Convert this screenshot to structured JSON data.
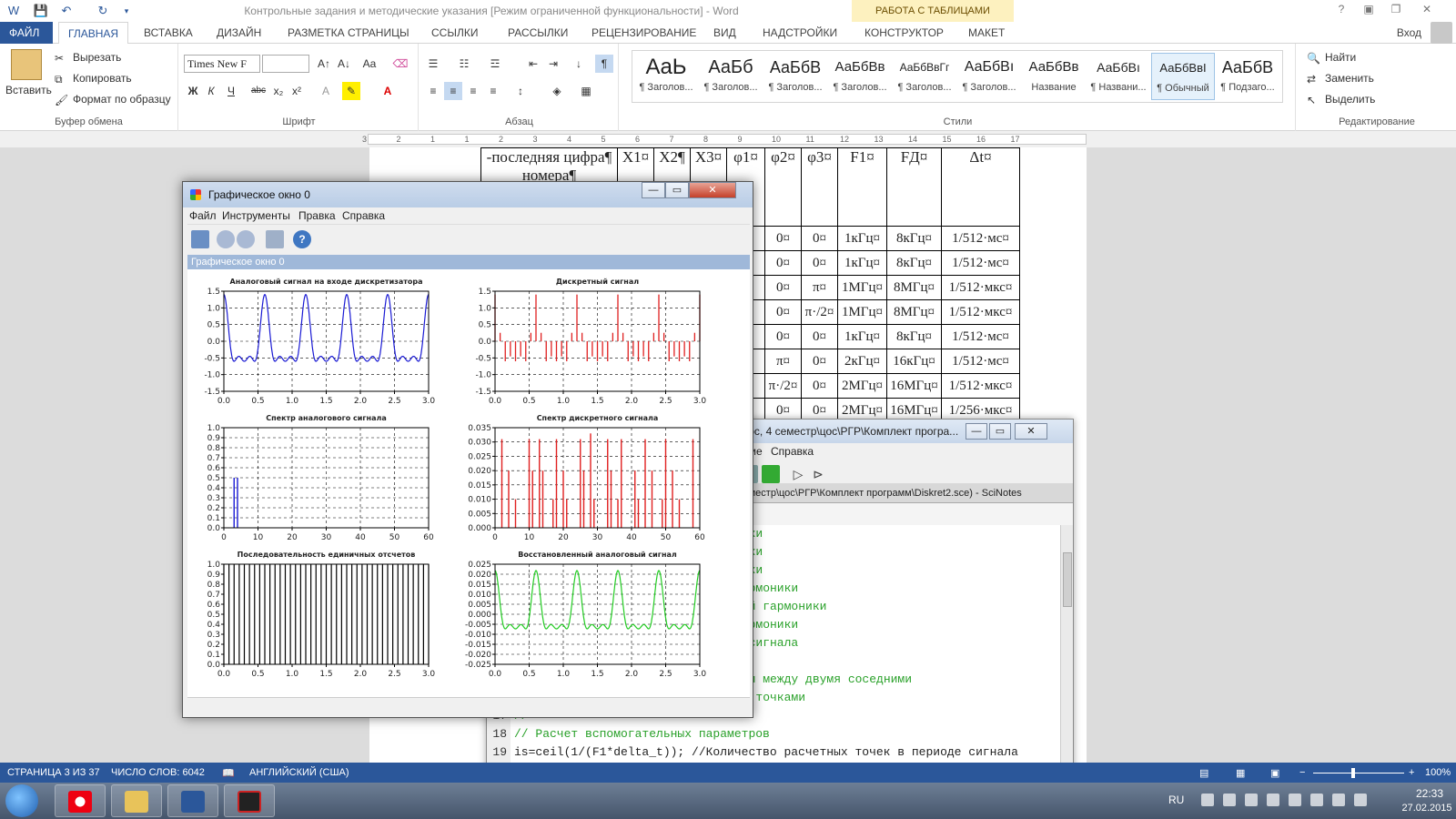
{
  "word": {
    "title": "Контрольные задания и методические указания [Режим ограниченной функциональности] - Word",
    "table_tools": "РАБОТА С ТАБЛИЦАМИ",
    "tabs": [
      "ФАЙЛ",
      "ГЛАВНАЯ",
      "ВСТАВКА",
      "ДИЗАЙН",
      "РАЗМЕТКА СТРАНИЦЫ",
      "ССЫЛКИ",
      "РАССЫЛКИ",
      "РЕЦЕНЗИРОВАНИЕ",
      "ВИД",
      "НАДСТРОЙКИ",
      "КОНСТРУКТОР",
      "МАКЕТ"
    ],
    "signin": "Вход",
    "clipboard": {
      "paste": "Вставить",
      "cut": "Вырезать",
      "copy": "Копировать",
      "format_painter": "Формат по образцу",
      "label": "Буфер обмена"
    },
    "font": {
      "name": "Times New F",
      "size": "",
      "label": "Шрифт"
    },
    "paragraph": {
      "label": "Абзац"
    },
    "styles": {
      "label": "Стили",
      "items": [
        {
          "sample": "AaЬ",
          "name": "¶ Заголов..."
        },
        {
          "sample": "АаБб",
          "name": "¶ Заголов..."
        },
        {
          "sample": "АаБбВ",
          "name": "¶ Заголов..."
        },
        {
          "sample": "АаБбВв",
          "name": "¶ Заголов..."
        },
        {
          "sample": "АаБбВвГг",
          "name": "¶ Заголов..."
        },
        {
          "sample": "АаБбВı",
          "name": "¶ Заголов..."
        },
        {
          "sample": "АаБбВв",
          "name": "Название"
        },
        {
          "sample": "АаБбВı",
          "name": "¶ Названи..."
        },
        {
          "sample": "АаБбВвI",
          "name": "¶ Обычный"
        },
        {
          "sample": "АаБбВ",
          "name": "¶ Подзаго..."
        }
      ]
    },
    "editing": {
      "find": "Найти",
      "replace": "Заменить",
      "select": "Выделить",
      "label": "Редактирование"
    },
    "ruler_numbers": [
      "3",
      "2",
      "1",
      "1",
      "2",
      "3",
      "4",
      "5",
      "6",
      "7",
      "8",
      "9",
      "10",
      "11",
      "12",
      "13",
      "14",
      "15",
      "16",
      "17"
    ],
    "table": {
      "header": [
        "-последняя цифра¶ номера¶",
        "X1¤",
        "X2¶",
        "X3¤",
        "φ1¤",
        "φ2¤",
        "φ3¤",
        "F1¤",
        "FД¤",
        "Δt¤"
      ],
      "rows": [
        [
          "",
          "",
          "",
          "",
          "0¤",
          "0¤",
          "0¤",
          "1кГц¤",
          "8кГц¤",
          "1/512·мс¤"
        ],
        [
          "",
          "",
          "",
          "",
          "0¤",
          "0¤",
          "0¤",
          "1кГц¤",
          "8кГц¤",
          "1/512·мс¤"
        ],
        [
          "",
          "",
          "",
          "",
          "0¤",
          "0¤",
          "π¤",
          "1МГц¤",
          "8МГц¤",
          "1/512·мкс¤"
        ],
        [
          "",
          "",
          "",
          "",
          "0¤",
          "0¤",
          "π·/2¤",
          "1МГц¤",
          "8МГц¤",
          "1/512·мкс¤"
        ],
        [
          "",
          "",
          "",
          "",
          "0¤",
          "0¤",
          "0¤",
          "1кГц¤",
          "8кГц¤",
          "1/512·мс¤"
        ],
        [
          "",
          "",
          "",
          "",
          "0¤",
          "π¤",
          "0¤",
          "2кГц¤",
          "16кГц¤",
          "1/512·мс¤"
        ],
        [
          "",
          "",
          "",
          "",
          "0¤",
          "π·/2¤",
          "0¤",
          "2МГц¤",
          "16МГц¤",
          "1/512·мкс¤"
        ],
        [
          "",
          "",
          "",
          "",
          "0¤",
          "0¤",
          "0¤",
          "2МГц¤",
          "16МГц¤",
          "1/256·мкс¤"
        ]
      ]
    },
    "status": {
      "page": "СТРАНИЦА 3 ИЗ 37",
      "words": "ЧИСЛО СЛОВ: 6042",
      "lang": "АНГЛИЙСКИЙ (США)",
      "zoom": "100%"
    }
  },
  "scinotes": {
    "title": "курс, 4 семестр\\цос\\РГР\\Комплект програ...",
    "menu": [
      "ение",
      "Справка"
    ],
    "tab": "семестр\\цос\\РГР\\Комплект программ\\Diskret2.sce) - SciNotes",
    "lines": [
      {
        "num": "",
        "code": "ники"
      },
      {
        "num": "",
        "code": "ники"
      },
      {
        "num": "",
        "code": "ники"
      },
      {
        "num": "",
        "code": "гармоники"
      },
      {
        "num": "",
        "code": "рой гармоники"
      },
      {
        "num": "",
        "code": "гармоники"
      },
      {
        "num": "",
        "code": "и сигнала"
      },
      {
        "num": "",
        "code": ""
      },
      {
        "num": "",
        "code": "вал между двумя соседними"
      },
      {
        "num": "",
        "code": "ми точками"
      },
      {
        "num": "17",
        "code": "//"
      },
      {
        "num": "18",
        "code": "// Расчет вспомогательных параметров"
      },
      {
        "num": "19",
        "code": "is=ceil(1/(F1*delta_t)); //Количество расчетных точек в периоде сигнала"
      },
      {
        "num": "20",
        "code": "id=ceil(1/(Fd*delta_t)); //Количество расчетных точек в интервале"
      }
    ]
  },
  "graphics": {
    "title": "Графическое окно 0",
    "menu": [
      "Файл",
      "Инструменты",
      "Правка",
      "Справка"
    ],
    "header": "Графическое окно 0"
  },
  "chart_data": [
    {
      "type": "line",
      "title": "Аналоговый сигнал на входе дискретизатора",
      "xlim": [
        0,
        3
      ],
      "ylim": [
        -1.5,
        1.5
      ],
      "xticks": [
        "0.0",
        "0.5",
        "1.0",
        "1.5",
        "2.0",
        "2.5",
        "3.0"
      ],
      "yticks": [
        "-1.5",
        "-1.0",
        "-0.5",
        "0.0",
        "0.5",
        "1.0",
        "1.5"
      ],
      "grid": true,
      "color": "#1a1ad4",
      "periods": 5
    },
    {
      "type": "bar",
      "title": "Дискретный сигнал",
      "xlim": [
        0,
        3
      ],
      "ylim": [
        -1.5,
        1.5
      ],
      "xticks": [
        "0.0",
        "0.5",
        "1.0",
        "1.5",
        "2.0",
        "2.5",
        "3.0"
      ],
      "yticks": [
        "-1.5",
        "-1.0",
        "-0.5",
        "0.0",
        "0.5",
        "1.0",
        "1.5"
      ],
      "grid": true,
      "color": "#e02020",
      "periods": 5,
      "samples_per_period": 8
    },
    {
      "type": "bar",
      "title": "Спектр аналогового сигнала",
      "xlim": [
        0,
        60
      ],
      "ylim": [
        0,
        1.0
      ],
      "xticks": [
        "0",
        "10",
        "20",
        "30",
        "40",
        "50",
        "60"
      ],
      "yticks": [
        "0.0",
        "0.1",
        "0.2",
        "0.3",
        "0.4",
        "0.5",
        "0.6",
        "0.7",
        "0.8",
        "0.9",
        "1.0"
      ],
      "grid": true,
      "color": "#1a1ad4",
      "x": [
        3,
        4
      ],
      "values": [
        0.5,
        0.5
      ]
    },
    {
      "type": "bar",
      "title": "Спектр дискретного сигнала",
      "xlim": [
        0,
        60
      ],
      "ylim": [
        0,
        0.035
      ],
      "xticks": [
        "0",
        "10",
        "20",
        "30",
        "40",
        "50",
        "60"
      ],
      "yticks": [
        "0.000",
        "0.005",
        "0.010",
        "0.015",
        "0.020",
        "0.025",
        "0.030",
        "0.035"
      ],
      "grid": true,
      "color": "#e02020",
      "x": [
        2,
        4,
        6,
        10,
        11,
        13,
        14,
        17,
        18,
        20,
        21,
        25,
        26,
        28,
        29,
        33,
        34,
        36,
        37,
        41,
        42,
        44,
        46,
        49,
        50,
        52,
        54,
        58
      ],
      "values": [
        0.031,
        0.02,
        0.01,
        0.031,
        0.02,
        0.031,
        0.02,
        0.01,
        0.031,
        0.02,
        0.01,
        0.031,
        0.02,
        0.033,
        0.01,
        0.031,
        0.02,
        0.01,
        0.031,
        0.02,
        0.01,
        0.031,
        0.02,
        0.01,
        0.031,
        0.02,
        0.01,
        0.031
      ]
    },
    {
      "type": "bar",
      "title": "Последовательность единичных отсчетов",
      "xlim": [
        0,
        3
      ],
      "ylim": [
        0,
        1.0
      ],
      "xticks": [
        "0.0",
        "0.5",
        "1.0",
        "1.5",
        "2.0",
        "2.5",
        "3.0"
      ],
      "yticks": [
        "0.0",
        "0.1",
        "0.2",
        "0.3",
        "0.4",
        "0.5",
        "0.6",
        "0.7",
        "0.8",
        "0.9",
        "1.0"
      ],
      "grid": false,
      "color": "#000000",
      "count": 40,
      "value": 1.0
    },
    {
      "type": "line",
      "title": "Восстановленный аналоговый сигнал",
      "xlim": [
        0,
        3
      ],
      "ylim": [
        -0.025,
        0.025
      ],
      "xticks": [
        "0.0",
        "0.5",
        "1.0",
        "1.5",
        "2.0",
        "2.5",
        "3.0"
      ],
      "yticks": [
        "-0.025",
        "-0.020",
        "-0.015",
        "-0.010",
        "-0.005",
        "0.000",
        "0.005",
        "0.010",
        "0.015",
        "0.020",
        "0.025"
      ],
      "grid": true,
      "color": "#22cc22",
      "periods": 5,
      "amplitude": 0.02
    }
  ],
  "taskbar": {
    "lang": "RU",
    "time": "22:33",
    "date": "27.02.2015"
  }
}
